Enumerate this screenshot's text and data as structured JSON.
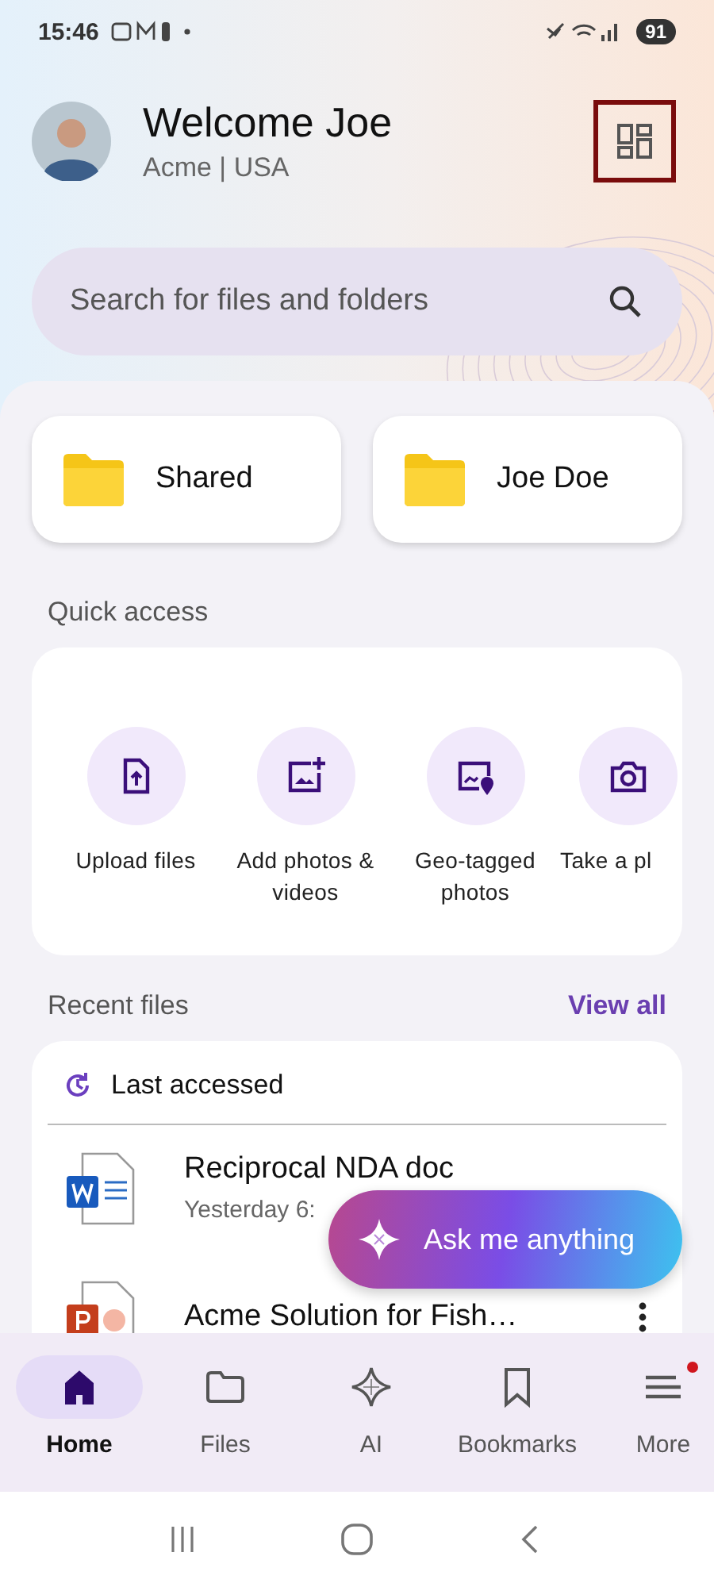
{
  "status_bar": {
    "time": "15:46",
    "battery": "91"
  },
  "header": {
    "title": "Welcome Joe",
    "subtitle": "Acme | USA"
  },
  "search": {
    "placeholder": "Search for files and folders"
  },
  "folders": [
    {
      "label": "Shared"
    },
    {
      "label": "Joe Doe"
    }
  ],
  "quick_access": {
    "title": "Quick access",
    "actions": [
      {
        "kind": "upload",
        "label": "Upload files"
      },
      {
        "kind": "add-photo",
        "label": "Add photos & videos"
      },
      {
        "kind": "geo",
        "label": "Geo-tagged photos"
      },
      {
        "kind": "camera",
        "label": "Take a pl"
      }
    ]
  },
  "recent": {
    "title": "Recent files",
    "link": "View all",
    "section": "Last accessed",
    "files": [
      {
        "kind": "word",
        "name": "Reciprocal NDA doc",
        "meta": "Yesterday 6:",
        "menu": false
      },
      {
        "kind": "powerpoint",
        "name": "Acme Solution for Fish…",
        "menu": true
      }
    ]
  },
  "fab": {
    "label": "Ask me anything"
  },
  "nav": [
    {
      "kind": "home",
      "label": "Home",
      "selected": true,
      "badge": false
    },
    {
      "kind": "files",
      "label": "Files",
      "selected": false,
      "badge": false
    },
    {
      "kind": "ai",
      "label": "AI",
      "selected": false,
      "badge": false
    },
    {
      "kind": "bookmarks",
      "label": "Bookmarks",
      "selected": false,
      "badge": false
    },
    {
      "kind": "more",
      "label": "More",
      "selected": false,
      "badge": true
    }
  ]
}
